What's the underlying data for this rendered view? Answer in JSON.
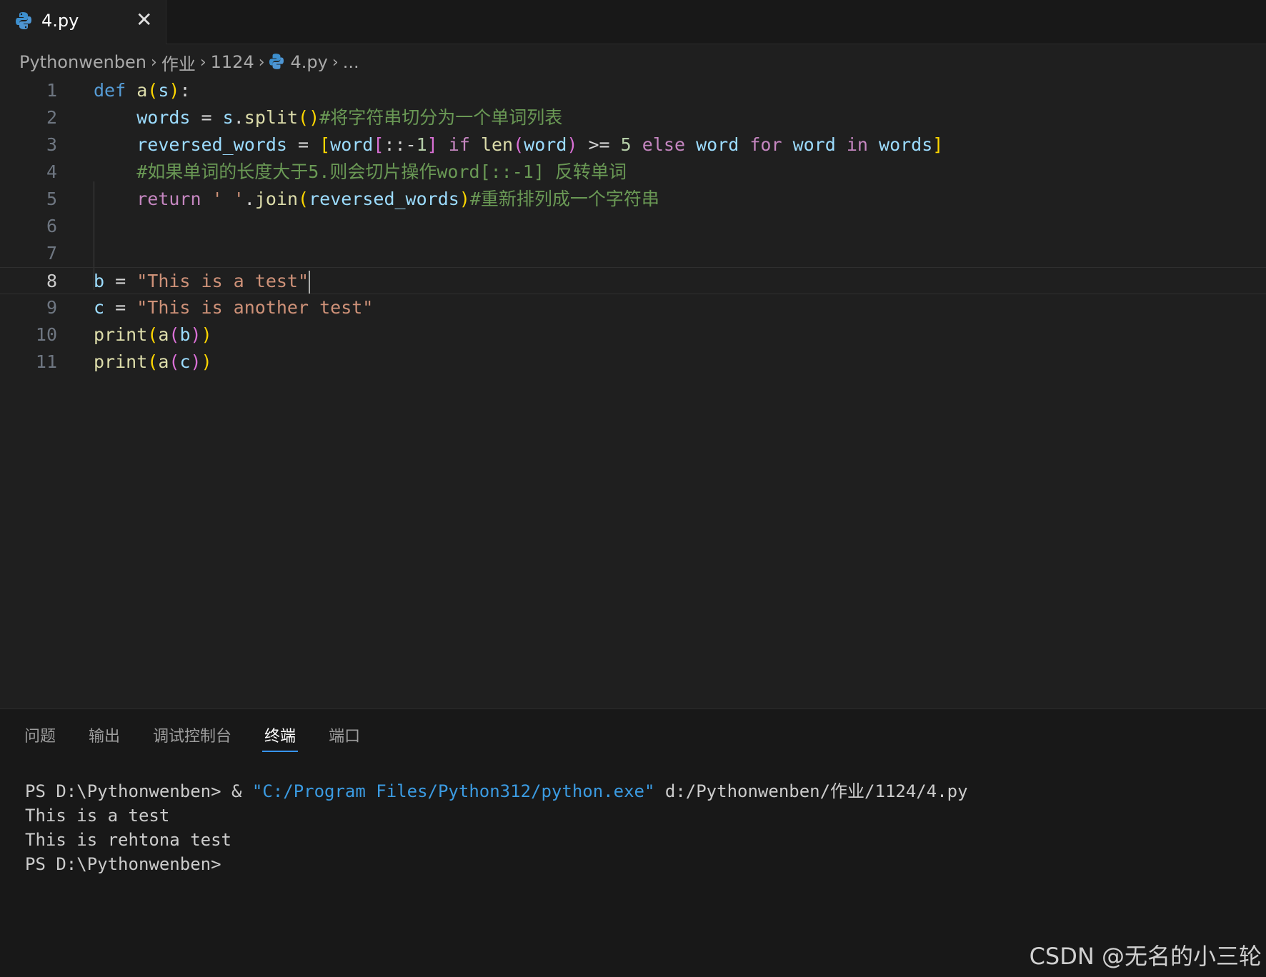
{
  "tab": {
    "label": "4.py",
    "icon": "python-icon",
    "close": "✕"
  },
  "breadcrumb": [
    {
      "label": "Pythonwenben"
    },
    {
      "label": "作业"
    },
    {
      "label": "1124"
    },
    {
      "label": "4.py",
      "icon": "python-icon"
    },
    {
      "label": "..."
    }
  ],
  "breadcrumb_sep": "›",
  "editor": {
    "active_line": 8,
    "line_numbers": [
      "1",
      "2",
      "3",
      "4",
      "5",
      "6",
      "7",
      "8",
      "9",
      "10",
      "11"
    ],
    "lines": [
      [
        {
          "t": "def",
          "c": "kw"
        },
        {
          "t": " "
        },
        {
          "t": "a",
          "c": "fn"
        },
        {
          "t": "(",
          "c": "b1"
        },
        {
          "t": "s",
          "c": "var"
        },
        {
          "t": ")",
          "c": "b1"
        },
        {
          "t": ":",
          "c": "op"
        }
      ],
      [
        {
          "t": "    "
        },
        {
          "t": "words",
          "c": "var"
        },
        {
          "t": " = ",
          "c": "op"
        },
        {
          "t": "s",
          "c": "var"
        },
        {
          "t": ".",
          "c": "op"
        },
        {
          "t": "split",
          "c": "fn"
        },
        {
          "t": "()",
          "c": "b1"
        },
        {
          "t": "#将字符串切分为一个单词列表",
          "c": "cmt"
        }
      ],
      [
        {
          "t": "    "
        },
        {
          "t": "reversed_words",
          "c": "var"
        },
        {
          "t": " = ",
          "c": "op"
        },
        {
          "t": "[",
          "c": "b1"
        },
        {
          "t": "word",
          "c": "var"
        },
        {
          "t": "[",
          "c": "b2"
        },
        {
          "t": "::-",
          "c": "op"
        },
        {
          "t": "1",
          "c": "num"
        },
        {
          "t": "]",
          "c": "b2"
        },
        {
          "t": " "
        },
        {
          "t": "if",
          "c": "ctl"
        },
        {
          "t": " "
        },
        {
          "t": "len",
          "c": "fn"
        },
        {
          "t": "(",
          "c": "b2"
        },
        {
          "t": "word",
          "c": "var"
        },
        {
          "t": ")",
          "c": "b2"
        },
        {
          "t": " >= ",
          "c": "op"
        },
        {
          "t": "5",
          "c": "num"
        },
        {
          "t": " "
        },
        {
          "t": "else",
          "c": "ctl"
        },
        {
          "t": " "
        },
        {
          "t": "word",
          "c": "var"
        },
        {
          "t": " "
        },
        {
          "t": "for",
          "c": "ctl"
        },
        {
          "t": " "
        },
        {
          "t": "word",
          "c": "var"
        },
        {
          "t": " "
        },
        {
          "t": "in",
          "c": "ctl"
        },
        {
          "t": " "
        },
        {
          "t": "words",
          "c": "var"
        },
        {
          "t": "]",
          "c": "b1"
        }
      ],
      [
        {
          "t": "    "
        },
        {
          "t": "#如果单词的长度大于5.则会切片操作word[::-1] 反转单词",
          "c": "cmt"
        }
      ],
      [
        {
          "t": "    "
        },
        {
          "t": "return",
          "c": "ctl"
        },
        {
          "t": " "
        },
        {
          "t": "' '",
          "c": "str"
        },
        {
          "t": ".",
          "c": "op"
        },
        {
          "t": "join",
          "c": "fn"
        },
        {
          "t": "(",
          "c": "b1"
        },
        {
          "t": "reversed_words",
          "c": "var"
        },
        {
          "t": ")",
          "c": "b1"
        },
        {
          "t": "#重新排列成一个字符串",
          "c": "cmt"
        }
      ],
      [],
      [],
      [
        {
          "t": "b",
          "c": "var"
        },
        {
          "t": " = ",
          "c": "op"
        },
        {
          "t": "\"This is a test\"",
          "c": "str"
        }
      ],
      [
        {
          "t": "c",
          "c": "var"
        },
        {
          "t": " = ",
          "c": "op"
        },
        {
          "t": "\"This is another test\"",
          "c": "str"
        }
      ],
      [
        {
          "t": "print",
          "c": "fn"
        },
        {
          "t": "(",
          "c": "b1"
        },
        {
          "t": "a",
          "c": "fn"
        },
        {
          "t": "(",
          "c": "b2"
        },
        {
          "t": "b",
          "c": "var"
        },
        {
          "t": ")",
          "c": "b2"
        },
        {
          "t": ")",
          "c": "b1"
        }
      ],
      [
        {
          "t": "print",
          "c": "fn"
        },
        {
          "t": "(",
          "c": "b1"
        },
        {
          "t": "a",
          "c": "fn"
        },
        {
          "t": "(",
          "c": "b2"
        },
        {
          "t": "c",
          "c": "var"
        },
        {
          "t": ")",
          "c": "b2"
        },
        {
          "t": ")",
          "c": "b1"
        }
      ]
    ]
  },
  "panel": {
    "tabs": [
      {
        "label": "问题",
        "active": false
      },
      {
        "label": "输出",
        "active": false
      },
      {
        "label": "调试控制台",
        "active": false
      },
      {
        "label": "终端",
        "active": true
      },
      {
        "label": "端口",
        "active": false
      }
    ]
  },
  "terminal": {
    "command_prompt": "PS D:\\Pythonwenben> & ",
    "command_exe": "\"C:/Program Files/Python312/python.exe\"",
    "command_arg": " d:/Pythonwenben/作业/1124/4.py",
    "output_lines": [
      "This is a test",
      "This is rehtona test"
    ],
    "final_prompt": "PS D:\\Pythonwenben>"
  },
  "watermark": "CSDN @无名的小三轮",
  "colors": {
    "accent": "#3794ff",
    "background": "#1f1f1f"
  }
}
